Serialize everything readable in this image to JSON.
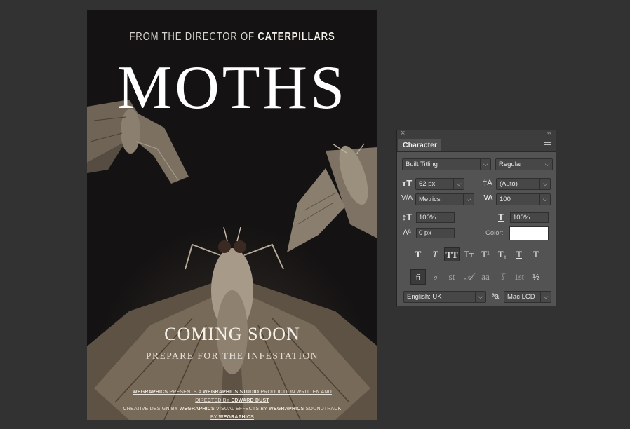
{
  "poster": {
    "tagline_prefix": "FROM THE DIRECTOR OF ",
    "tagline_strong": "CATERPILLARS",
    "title": "MOTHS",
    "coming_soon": "COMING SOON",
    "subtitle": "PREPARE FOR THE INFESTATION",
    "credits": {
      "line1_a": "WEGRAPHICS",
      "line1_b": " PRESENTS A ",
      "line1_c": "WEGRAPHICS STUDIO",
      "line1_d": " PRODUCTION WRITTEN AND DIRECTED BY ",
      "line1_e": "EDWARD DUST",
      "line2_a": "CREATIVE DESIGN BY ",
      "line2_b": "WEGRAPHICS",
      "line2_c": " VISUAL EFFECTS BY ",
      "line2_d": "WEGRAPHICS",
      "line2_e": " SOUNDTRACK BY ",
      "line2_f": "WEGRAPHICS"
    }
  },
  "panel": {
    "close_icon": "×",
    "collapse_icon": "‹‹",
    "tab": "Character",
    "font_family": "Built Titling",
    "font_style": "Regular",
    "font_size": "62 px",
    "leading": "(Auto)",
    "kerning": "Metrics",
    "tracking": "100",
    "vertical_scale": "100%",
    "horizontal_scale": "100%",
    "baseline_shift": "0 px",
    "color_label": "Color:",
    "color_value": "#ffffff",
    "type_buttons": [
      "T",
      "T",
      "TT",
      "Tт",
      "T¹",
      "T₁",
      "T",
      "T"
    ],
    "opentype_buttons": [
      "ﬁ",
      "ℴ",
      "st",
      "𝒜",
      "aa",
      "𝕋",
      "1st",
      "½"
    ],
    "language": "English: UK",
    "antialias_icon": "ªa",
    "antialias": "Mac LCD",
    "dropdown_arrow": "⌵"
  }
}
